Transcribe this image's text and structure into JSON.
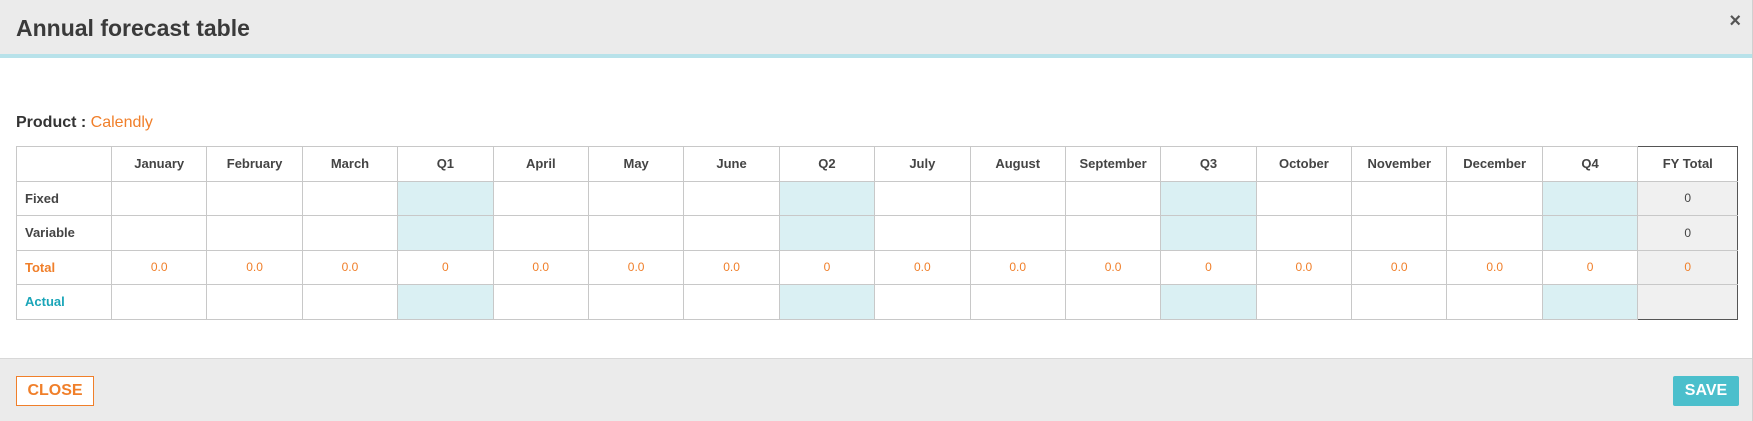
{
  "modal": {
    "title": "Annual forecast table",
    "close_icon": "close-icon",
    "close_glyph": "×"
  },
  "product": {
    "label": "Product : ",
    "value": "Calendly"
  },
  "table": {
    "columns": [
      "",
      "January",
      "February",
      "March",
      "Q1",
      "April",
      "May",
      "June",
      "Q2",
      "July",
      "August",
      "September",
      "Q3",
      "October",
      "November",
      "December",
      "Q4",
      "FY Total"
    ],
    "rows": [
      {
        "label": "Fixed",
        "cells": [
          "",
          "",
          "",
          "",
          "",
          "",
          "",
          "",
          "",
          "",
          "",
          "",
          "",
          "",
          "",
          "",
          "0"
        ]
      },
      {
        "label": "Variable",
        "cells": [
          "",
          "",
          "",
          "",
          "",
          "",
          "",
          "",
          "",
          "",
          "",
          "",
          "",
          "",
          "",
          "",
          "0"
        ]
      },
      {
        "label": "Total",
        "cells": [
          "0.0",
          "0.0",
          "0.0",
          "0",
          "0.0",
          "0.0",
          "0.0",
          "0",
          "0.0",
          "0.0",
          "0.0",
          "0",
          "0.0",
          "0.0",
          "0.0",
          "0",
          "0"
        ]
      },
      {
        "label": "Actual",
        "cells": [
          "",
          "",
          "",
          "",
          "",
          "",
          "",
          "",
          "",
          "",
          "",
          "",
          "",
          "",
          "",
          "",
          ""
        ]
      }
    ]
  },
  "footer": {
    "close_label": "CLOSE",
    "save_label": "SAVE"
  },
  "colors": {
    "accent_orange": "#f07f2a",
    "accent_teal": "#4bbfcc",
    "quarter_bg": "#daf0f3"
  }
}
